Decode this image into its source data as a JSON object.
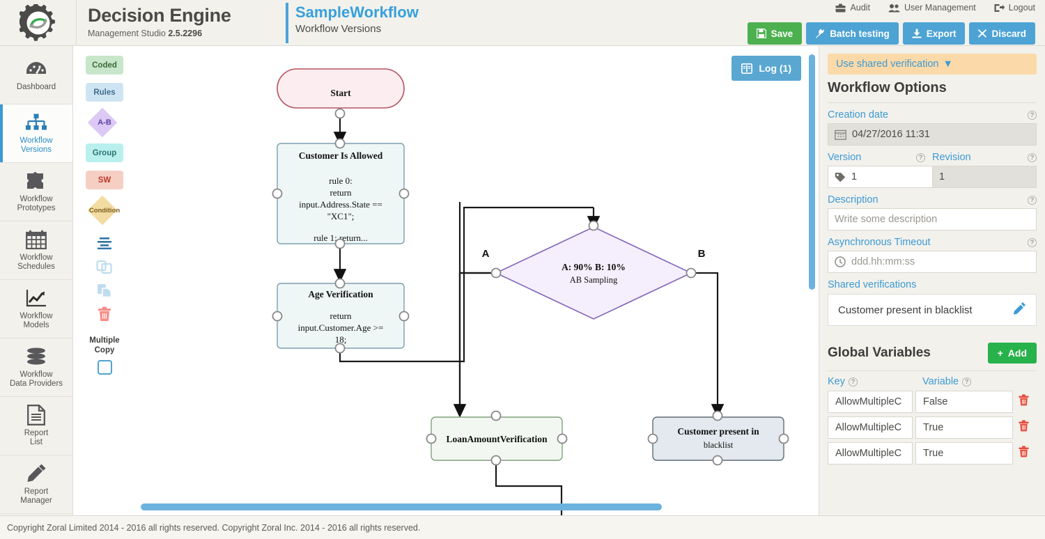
{
  "header": {
    "brand_title": "Decision Engine",
    "brand_sub_prefix": "Management Studio ",
    "brand_version": "2.5.2296",
    "workflow_name": "SampleWorkflow",
    "workflow_sub": "Workflow Versions",
    "nav": [
      {
        "label": "Audit",
        "icon": "briefcase-icon"
      },
      {
        "label": "User Management",
        "icon": "users-icon"
      },
      {
        "label": "Logout",
        "icon": "logout-icon"
      }
    ],
    "buttons": [
      {
        "label": "Save",
        "icon": "save-icon",
        "color": "#4cb04f"
      },
      {
        "label": "Batch testing",
        "icon": "wrench-icon",
        "color": "#4da3d4"
      },
      {
        "label": "Export",
        "icon": "download-icon",
        "color": "#4da3d4"
      },
      {
        "label": "Discard",
        "icon": "close-icon",
        "color": "#4da3d4"
      }
    ]
  },
  "sidebar": {
    "items": [
      {
        "label": "Dashboard",
        "icon": "dashboard-icon",
        "active": false
      },
      {
        "label": "Workflow\nVersions",
        "line1": "Workflow",
        "line2": "Versions",
        "icon": "sitemap-icon",
        "active": true
      },
      {
        "label": "Workflow Prototypes",
        "line1": "Workflow",
        "line2": "Prototypes",
        "icon": "puzzle-icon",
        "active": false
      },
      {
        "label": "Workflow Schedules",
        "line1": "Workflow",
        "line2": "Schedules",
        "icon": "calendar-icon",
        "active": false
      },
      {
        "label": "Workflow Models",
        "line1": "Workflow",
        "line2": "Models",
        "icon": "chart-line-icon",
        "active": false
      },
      {
        "label": "Workflow Data Providers",
        "line1": "Workflow",
        "line2": "Data Providers",
        "icon": "database-icon",
        "active": false
      },
      {
        "label": "Report List",
        "line1": "Report",
        "line2": "List",
        "icon": "document-icon",
        "active": false
      },
      {
        "label": "Report Manager",
        "line1": "Report",
        "line2": "Manager",
        "icon": "pencil-icon",
        "active": false
      }
    ]
  },
  "palette": {
    "chips": [
      {
        "label": "Coded",
        "shape": "rect",
        "style": "chip-coded"
      },
      {
        "label": "Rules",
        "shape": "rect",
        "style": "chip-rules"
      },
      {
        "label": "A-B",
        "shape": "diamond",
        "style": "dm-ab"
      },
      {
        "label": "Group",
        "shape": "rect",
        "style": "chip-group"
      },
      {
        "label": "SW",
        "shape": "rect",
        "style": "chip-sw"
      },
      {
        "label": "Condition",
        "shape": "diamond",
        "style": "dm-cond"
      }
    ],
    "tools": [
      {
        "icon": "align-icon"
      },
      {
        "icon": "copy-icon"
      },
      {
        "icon": "paste-icon"
      },
      {
        "icon": "trash-icon"
      }
    ],
    "multiple_copy_line1": "Multiple",
    "multiple_copy_line2": "Copy"
  },
  "canvas": {
    "log_button": "Log (1)",
    "log_icon": "book-icon",
    "nodes": [
      {
        "id": "start",
        "type": "start",
        "title": "Start",
        "body": []
      },
      {
        "id": "customer_is_allowed",
        "type": "rules",
        "title": "Customer Is Allowed",
        "body": [
          "rule 0:",
          "return",
          "input.Address.State ==",
          "\"XC1\";",
          "",
          "rule 1: return..."
        ]
      },
      {
        "id": "age_verification",
        "type": "rules",
        "title": "Age Verification",
        "body": [
          "return",
          "input.Customer.Age >=",
          "18;"
        ]
      },
      {
        "id": "ab_sampling",
        "type": "ab",
        "title": "A: 90% B: 10%",
        "subtitle": "AB Sampling"
      },
      {
        "id": "loan_amount_verification",
        "type": "coded",
        "title": "LoanAmountVerification",
        "body": []
      },
      {
        "id": "customer_present_blacklist",
        "type": "group",
        "title": "Customer present in",
        "subtitle": "blacklist"
      }
    ],
    "branch_labels": {
      "a": "A",
      "b": "B"
    }
  },
  "right_panel": {
    "shared_verification_button": "Use shared verification",
    "title": "Workflow Options",
    "creation_date": {
      "label": "Creation date",
      "value": "04/27/2016 11:31",
      "icon": "calendar-icon"
    },
    "version": {
      "label": "Version",
      "value": "1",
      "icon": "tag-icon"
    },
    "revision": {
      "label": "Revision",
      "value": "1"
    },
    "description": {
      "label": "Description",
      "placeholder": "Write some description",
      "value": ""
    },
    "async_timeout": {
      "label": "Asynchronous Timeout",
      "placeholder": "ddd.hh:mm:ss",
      "value": "",
      "icon": "clock-icon"
    },
    "shared_verifications": {
      "label": "Shared verifications",
      "items": [
        {
          "name": "Customer present in blacklist",
          "action_icon": "pencil-icon"
        }
      ]
    },
    "global_variables": {
      "title": "Global Variables",
      "add_label": "Add",
      "columns": [
        "Key",
        "Variable"
      ],
      "rows": [
        {
          "key": "AllowMultipleC",
          "value": "False"
        },
        {
          "key": "AllowMultipleC",
          "value": "True"
        },
        {
          "key": "AllowMultipleC",
          "value": "True"
        }
      ]
    }
  },
  "footer": {
    "copyright": "Copyright Zoral Limited 2014 - 2016 all rights reserved. Copyright Zoral Inc. 2014 - 2016 all rights reserved."
  },
  "colors": {
    "accent_blue": "#3d9ad4",
    "green": "#4cb04f",
    "orange": "#fbd9a8",
    "header_bg": "#f2f1ec"
  }
}
